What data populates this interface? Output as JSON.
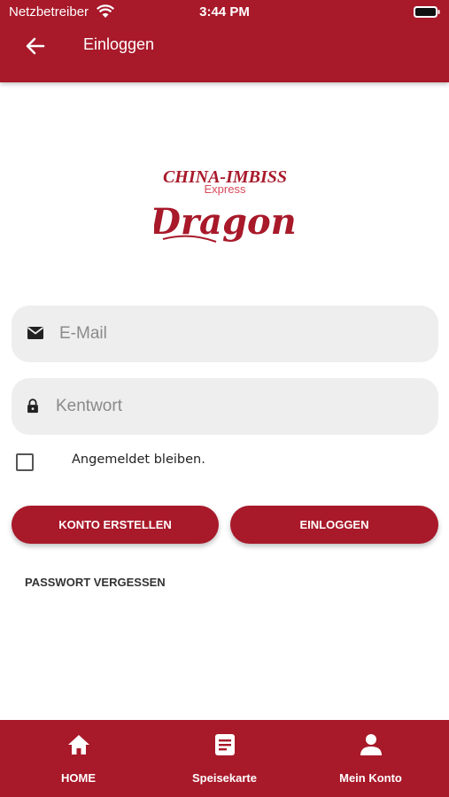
{
  "status_bar": {
    "carrier": "Netzbetreiber",
    "time": "3:44 PM"
  },
  "header": {
    "title": "Einloggen",
    "back_icon": "arrow-left-icon"
  },
  "logo": {
    "line1": "CHINA-IMBISS",
    "line2": "Express",
    "line3": "Dragon"
  },
  "form": {
    "email": {
      "placeholder": "E-Mail",
      "value": "",
      "icon": "envelope-icon"
    },
    "password": {
      "placeholder": "Kentwort",
      "value": "",
      "icon": "lock-icon"
    },
    "remember": {
      "label": "Angemeldet bleiben.",
      "checked": false
    }
  },
  "buttons": {
    "create_account": "KONTO ERSTELLEN",
    "login": "EINLOGGEN",
    "forgot_password": "PASSWORT VERGESSEN"
  },
  "bottom_nav": {
    "items": [
      {
        "label": "HOME",
        "icon": "home-icon"
      },
      {
        "label": "Speisekarte",
        "icon": "menu-card-icon"
      },
      {
        "label": "Mein Konto",
        "icon": "person-icon"
      }
    ]
  },
  "colors": {
    "brand": "#a8192a",
    "field_bg": "#eeeeee"
  }
}
